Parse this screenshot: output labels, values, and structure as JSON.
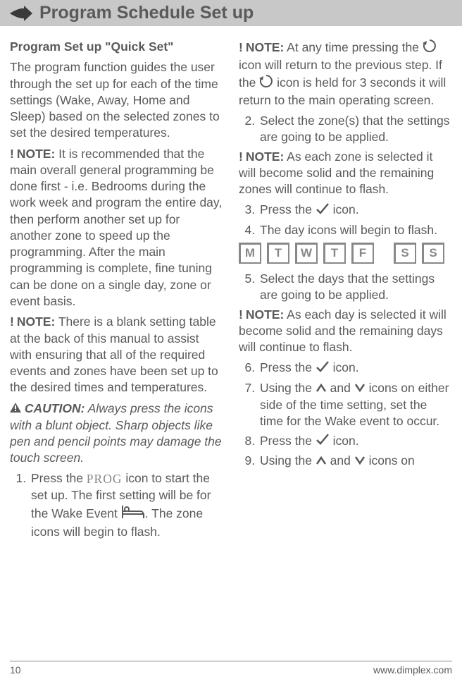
{
  "header": {
    "title": "Program Schedule Set up"
  },
  "left": {
    "heading": "Program Set up \"Quick Set\"",
    "p1": "The program function guides the user through the set up for each of the time settings (Wake, Away, Home and Sleep) based on the selected zones to set the desired temperatures.",
    "note1_label": "NOTE:",
    "note1_body": " It is recommended that the main overall general programming be done first - i.e. Bedrooms during the work week and program the entire day, then perform another set up for another zone to speed up the programming.  After the main programming is complete, fine tuning can be done on a single day, zone or event basis.",
    "note2_label": "NOTE:",
    "note2_body": " There is a blank setting table at the back of this manual to assist with ensuring that all of the required events and zones have been set up to the desired times and temperatures.",
    "caution_label": "CAUTION:",
    "caution_body": " Always press the icons with a blunt object. Sharp objects like pen and pencil points may damage the touch screen.",
    "step1_a": "Press the ",
    "step1_prog": "PROG",
    "step1_b": " icon to start the set up.  The first setting will be for the Wake Event ",
    "step1_c": ". The zone icons will begin to flash."
  },
  "right": {
    "note1_label": "NOTE:",
    "note1_a": " At any time pressing the ",
    "note1_b": " icon will return to the previous step.  If the ",
    "note1_c": " icon is held for 3 seconds it will return to the main operating screen.",
    "step2": "Select the zone(s) that the settings are going to be applied.",
    "note2_label": "NOTE:",
    "note2_body": " As each zone is selected it will become solid and the remaining zones will continue to flash.",
    "step3_a": "Press the ",
    "step3_b": " icon.",
    "step4": "The day icons will begin to flash.",
    "days": [
      "M",
      "T",
      "W",
      "T",
      "F",
      "S",
      "S"
    ],
    "step5": "Select the days that the settings are going to be applied.",
    "note3_label": "NOTE:",
    "note3_body": " As each day is selected it will become solid and the remaining days will continue to flash.",
    "step6_a": "Press the ",
    "step6_b": " icon.",
    "step7_a": "Using the ",
    "step7_b": " and ",
    "step7_c": " icons on either side of the time setting, set the time for the Wake event to occur.",
    "step8_a": "Press the ",
    "step8_b": " icon.",
    "step9_a": "Using the ",
    "step9_b": " and ",
    "step9_c": " icons on"
  },
  "footer": {
    "page": "10",
    "url": "www.dimplex.com"
  }
}
